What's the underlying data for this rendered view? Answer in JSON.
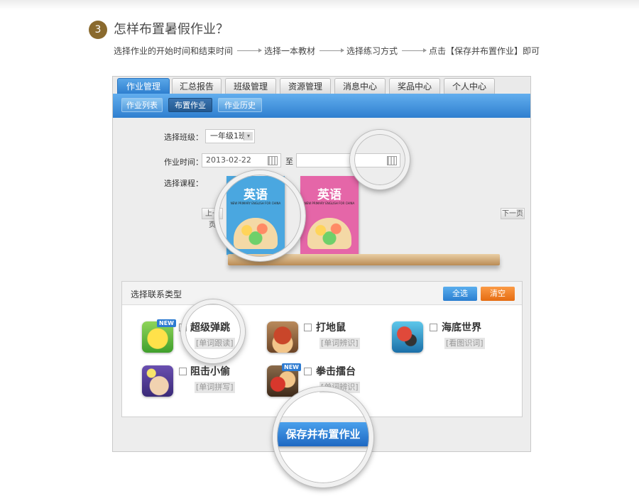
{
  "header": {
    "step_number": "3",
    "title": "怎样布置暑假作业？",
    "steps": [
      "选择作业的开始时间和结束时间",
      "选择一本教材",
      "选择练习方式",
      "点击【保存并布置作业】即可"
    ]
  },
  "tabs": [
    "作业管理",
    "汇总报告",
    "班级管理",
    "资源管理",
    "消息中心",
    "奖品中心",
    "个人中心"
  ],
  "subtabs": [
    "作业列表",
    "布置作业",
    "作业历史"
  ],
  "form": {
    "class_label": "选择班级：",
    "class_value": "一年级1班",
    "time_label": "作业时间：",
    "start_date": "2013-02-22",
    "to_label": "至",
    "end_date": "",
    "course_label": "选择课程：",
    "prev_label": "上一页",
    "next_label": "下一页"
  },
  "books": [
    {
      "title": "英语",
      "subtitle": "NEW PRIMARY ENGLISH FOR CHINA",
      "color": "#4aa7e0"
    },
    {
      "title": "英语",
      "subtitle": "NEW PRIMARY ENGLISH FOR CHINA",
      "color": "#e566a8"
    }
  ],
  "practice": {
    "title": "选择联系类型",
    "select_all": "全选",
    "clear": "清空",
    "games": [
      {
        "name": "超级弹跳",
        "tag": "[单词跟读]",
        "icon": "chick-game-icon",
        "is_new": true,
        "new_label": "NEW"
      },
      {
        "name": "打地鼠",
        "tag": "[单词辨识]",
        "icon": "mole-game-icon",
        "is_new": false
      },
      {
        "name": "海底世界",
        "tag": "[看图识词]",
        "icon": "ocean-game-icon",
        "is_new": false
      },
      {
        "name": "阻击小偷",
        "tag": "[单词拼写]",
        "icon": "thief-game-icon",
        "is_new": false
      },
      {
        "name": "拳击擂台",
        "tag": "[单词辨识]",
        "icon": "boxing-game-icon",
        "is_new": true,
        "new_label": "NEW"
      }
    ]
  },
  "save_button": "保存并布置作业",
  "colors": {
    "accent_blue": "#2e7fcf",
    "clear_orange": "#f07a1c",
    "badge_brown": "#8a6a2e"
  }
}
